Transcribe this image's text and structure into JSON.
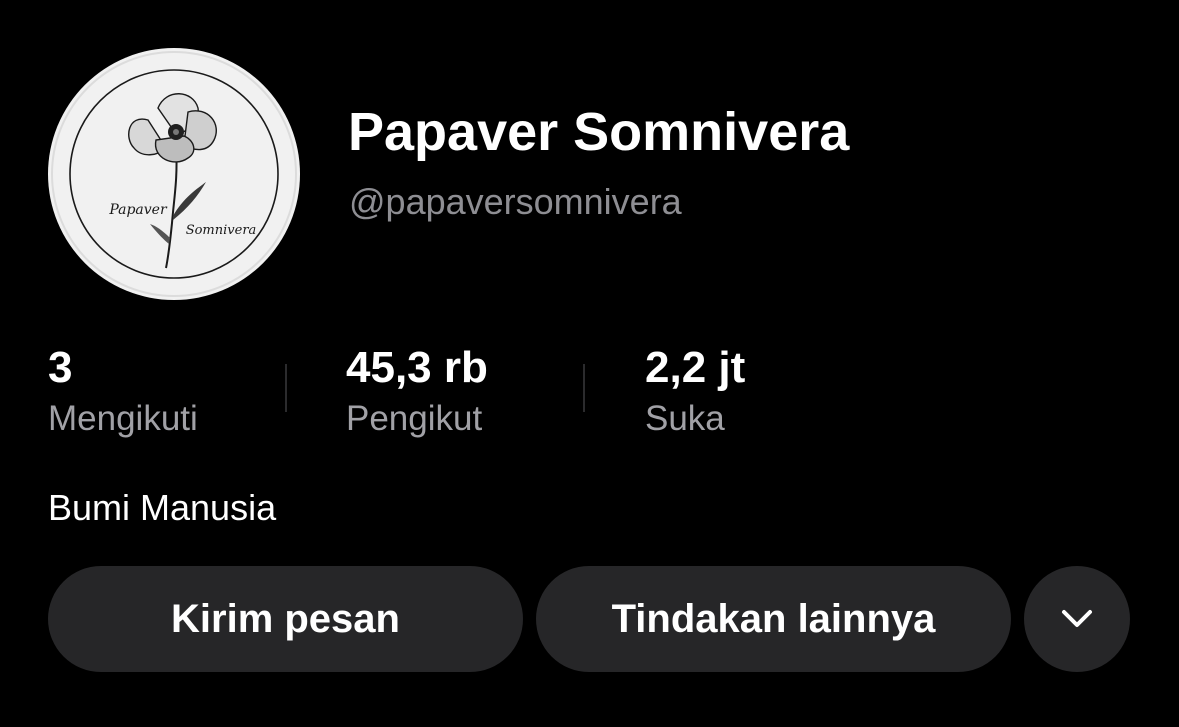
{
  "profile": {
    "display_name": "Papaver Somnivera",
    "username": "@papaversomnivera",
    "bio": "Bumi Manusia",
    "avatar_text_1": "Papaver",
    "avatar_text_2": "Somnivera",
    "avatar_background": "#f1f1f1"
  },
  "stats": {
    "following": {
      "value": "3",
      "label": "Mengikuti"
    },
    "followers": {
      "value": "45,3 rb",
      "label": "Pengikut"
    },
    "likes": {
      "value": "2,2 jt",
      "label": "Suka"
    }
  },
  "actions": {
    "message_label": "Kirim pesan",
    "more_label": "Tindakan lainnya",
    "expand_icon": "chevron-down-icon"
  },
  "colors": {
    "background": "#000000",
    "button": "#262628",
    "muted_text": "#8e8e93",
    "label_text": "#a1a1a6"
  }
}
